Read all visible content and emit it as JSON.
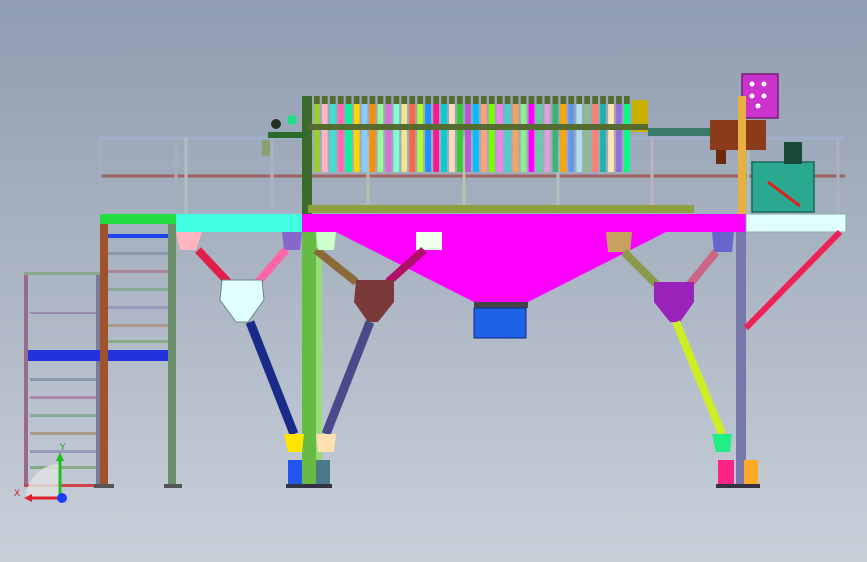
{
  "viewport": {
    "background_top": "#8f9db0",
    "background_bottom": "#c9d0da"
  },
  "model": {
    "plate_colors": [
      "#9acd32",
      "#ffb6c1",
      "#40e0d0",
      "#ff69b4",
      "#00fa9a",
      "#ffd700",
      "#87cefa",
      "#ff8c00",
      "#98fb98",
      "#da70d6",
      "#7fffd4",
      "#f0e68c",
      "#ff6347",
      "#adff2f",
      "#1e90ff",
      "#ff1493",
      "#00ced1",
      "#ffdab9",
      "#32cd32",
      "#ba55d3",
      "#00bfff",
      "#ffa07a",
      "#7cfc00",
      "#ee82ee",
      "#48d1cc",
      "#f4a460",
      "#90ee90",
      "#ff00ff",
      "#66cdaa",
      "#dda0dd",
      "#3cb371",
      "#ffa500",
      "#6495ed",
      "#b0e0e6",
      "#8fbc8f",
      "#fa8072",
      "#20b2aa",
      "#ffe4b5",
      "#9370db",
      "#00ff7f"
    ],
    "hopper_color": "#ff00ff",
    "discharge_color": "#1e63e6",
    "deck_color": "#40ffe0",
    "control_box_color": "#cc33cc",
    "railing_color": "#a0b8b8"
  },
  "triad": {
    "x_label": "X",
    "y_label": "Y",
    "x_color": "#e0202a",
    "y_color": "#1fbf1f",
    "z_color": "#1a3cff"
  }
}
